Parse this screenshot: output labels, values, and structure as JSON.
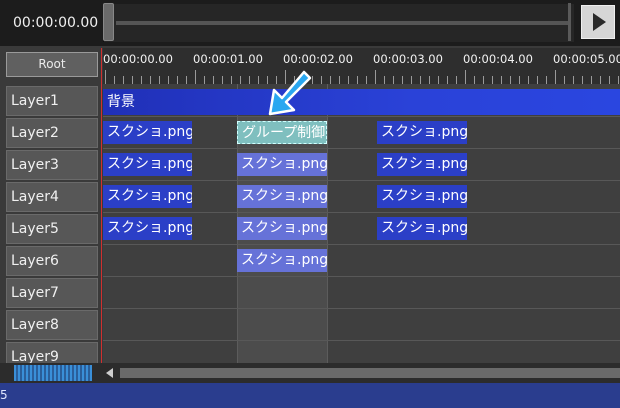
{
  "transport": {
    "time": "00:00:00.00",
    "play_icon": "play-icon"
  },
  "root_button": "Root",
  "ruler": {
    "labels": [
      "00:00:00.00",
      "00:00:01.00",
      "00:00:02.00",
      "00:00:03.00",
      "00:00:04.00",
      "00:00:05.00"
    ]
  },
  "layers": [
    "Layer1",
    "Layer2",
    "Layer3",
    "Layer4",
    "Layer5",
    "Layer6",
    "Layer7",
    "Layer8",
    "Layer9"
  ],
  "clips": {
    "background": "背景",
    "image": "スクショ.png",
    "group_control": "グループ制御"
  },
  "status": {
    "text": "5"
  },
  "colors": {
    "clip": "#2b3fc7",
    "clip_in_group": "#6672d8",
    "group_control": "#7fbfbf",
    "playhead": "#d03030",
    "arrow": "#2aa7f0",
    "statusbar": "#2a3d8e"
  }
}
